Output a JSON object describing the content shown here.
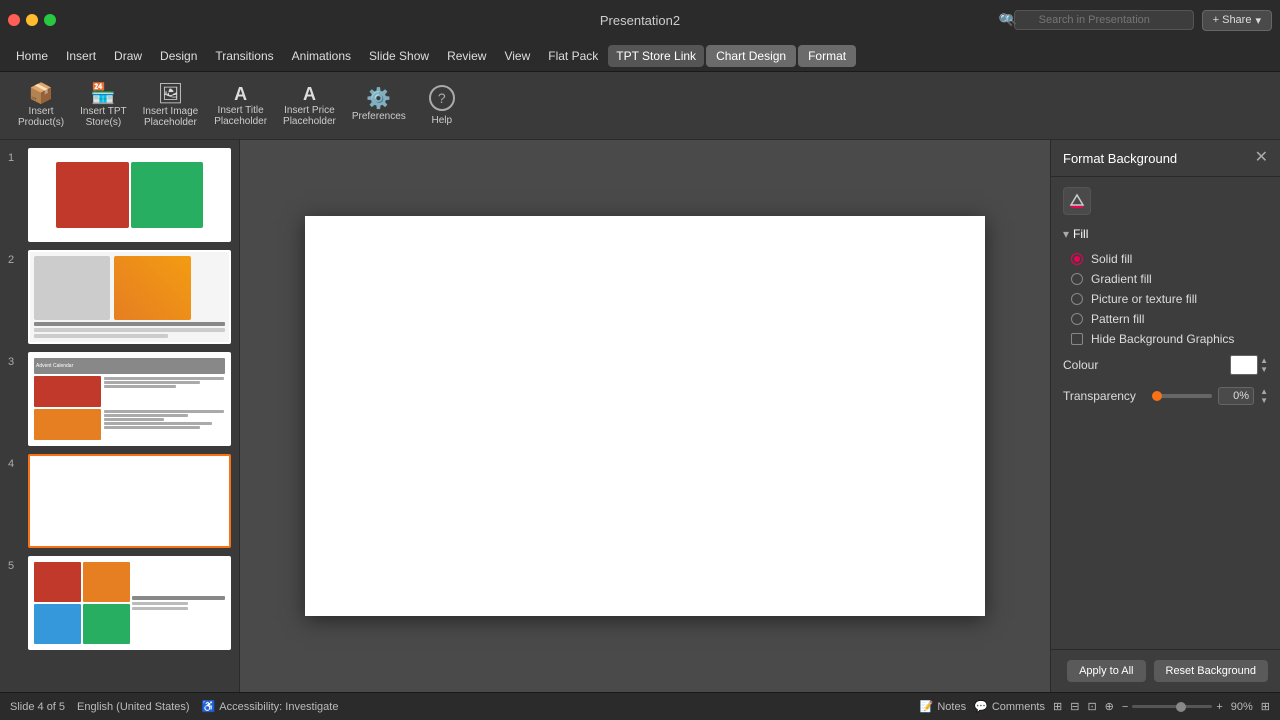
{
  "app": {
    "title": "Presentation2",
    "window_controls": {
      "close": "×",
      "minimize": "−",
      "maximize": "+"
    }
  },
  "title_bar": {
    "title": "Presentation2",
    "search_placeholder": "Search in Presentation",
    "share_label": "+ Share"
  },
  "menu": {
    "items": [
      {
        "id": "home",
        "label": "Home"
      },
      {
        "id": "insert",
        "label": "Insert"
      },
      {
        "id": "draw",
        "label": "Draw"
      },
      {
        "id": "design",
        "label": "Design"
      },
      {
        "id": "transitions",
        "label": "Transitions"
      },
      {
        "id": "animations",
        "label": "Animations"
      },
      {
        "id": "slideshow",
        "label": "Slide Show"
      },
      {
        "id": "review",
        "label": "Review"
      },
      {
        "id": "view",
        "label": "View"
      },
      {
        "id": "flatpack",
        "label": "Flat Pack"
      },
      {
        "id": "tpt-store-link",
        "label": "TPT Store Link"
      },
      {
        "id": "chart-design",
        "label": "Chart Design"
      },
      {
        "id": "format",
        "label": "Format"
      }
    ]
  },
  "toolbar": {
    "buttons": [
      {
        "id": "insert-products",
        "icon": "📦",
        "label": "Insert\nProduct(s)"
      },
      {
        "id": "insert-tpt",
        "icon": "🏪",
        "label": "Insert TPT\nStore(s)"
      },
      {
        "id": "insert-image",
        "icon": "🖼",
        "label": "Insert Image\nPlaceholder"
      },
      {
        "id": "insert-title",
        "icon": "T",
        "label": "Insert Title\nPlaceholder"
      },
      {
        "id": "insert-price",
        "icon": "$",
        "label": "Insert Price\nPlaceholder"
      },
      {
        "id": "preferences",
        "icon": "⚙",
        "label": "Preferences"
      },
      {
        "id": "help",
        "icon": "?",
        "label": "Help"
      }
    ]
  },
  "slides": [
    {
      "number": "1",
      "selected": false
    },
    {
      "number": "2",
      "selected": false
    },
    {
      "number": "3",
      "selected": false
    },
    {
      "number": "4",
      "selected": true
    },
    {
      "number": "5",
      "selected": false
    }
  ],
  "right_panel": {
    "title": "Format Background",
    "fill_section": {
      "label": "Fill",
      "options": [
        {
          "id": "solid",
          "label": "Solid fill",
          "selected": true
        },
        {
          "id": "gradient",
          "label": "Gradient fill",
          "selected": false
        },
        {
          "id": "picture",
          "label": "Picture or texture fill",
          "selected": false
        },
        {
          "id": "pattern",
          "label": "Pattern fill",
          "selected": false
        }
      ],
      "hide_background": {
        "label": "Hide Background Graphics",
        "checked": false
      }
    },
    "colour": {
      "label": "Colour",
      "value": "#ffffff"
    },
    "transparency": {
      "label": "Transparency",
      "value": "0%",
      "slider_position": 0
    },
    "buttons": {
      "apply_to_all": "Apply to All",
      "reset_background": "Reset Background"
    }
  },
  "status_bar": {
    "slide_info": "Slide 4 of 5",
    "language": "English (United States)",
    "accessibility": "Accessibility: Investigate",
    "notes": "Notes",
    "comments": "Comments",
    "zoom": "90%",
    "icons": {
      "notes": "📝",
      "comments": "💬",
      "grid_view": "⊞",
      "fit_to_window": "⊡"
    }
  }
}
